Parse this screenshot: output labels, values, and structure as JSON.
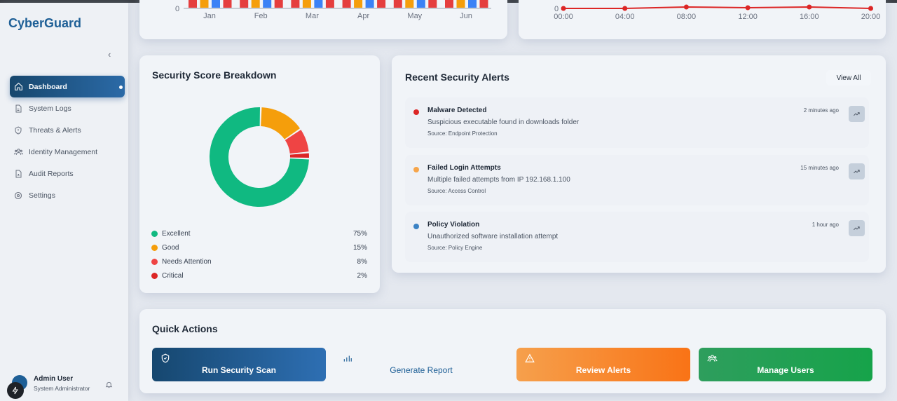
{
  "app": {
    "brand": "CyberGuard"
  },
  "sidebar": {
    "items": [
      {
        "label": "Dashboard",
        "icon": "home-icon",
        "active": true
      },
      {
        "label": "System Logs",
        "icon": "document-icon"
      },
      {
        "label": "Threats & Alerts",
        "icon": "shield-alert-icon"
      },
      {
        "label": "Identity Management",
        "icon": "users-icon"
      },
      {
        "label": "Audit Reports",
        "icon": "report-icon"
      },
      {
        "label": "Settings",
        "icon": "gear-icon"
      }
    ],
    "user": {
      "name": "Admin User",
      "role": "System Administrator"
    }
  },
  "top_bar_chart": {
    "months": [
      "Jan",
      "Feb",
      "Mar",
      "Apr",
      "May",
      "Jun"
    ],
    "y_tick": "0",
    "colors": [
      "#e53e3e",
      "#f59e0b",
      "#3b82f6"
    ]
  },
  "top_line_chart": {
    "times": [
      "00:00",
      "04:00",
      "08:00",
      "12:00",
      "16:00",
      "20:00"
    ],
    "y_tick": "0",
    "color": "#dc2626"
  },
  "score": {
    "title": "Security Score Breakdown",
    "chart_data": {
      "type": "pie",
      "categories": [
        "Excellent",
        "Good",
        "Needs Attention",
        "Critical"
      ],
      "values": [
        75,
        15,
        8,
        2
      ],
      "colors": [
        "#10b981",
        "#f59e0b",
        "#ef4444",
        "#dc2626"
      ]
    },
    "legend": [
      {
        "label": "Excellent",
        "pct": "75%",
        "color": "#10b981"
      },
      {
        "label": "Good",
        "pct": "15%",
        "color": "#f59e0b"
      },
      {
        "label": "Needs Attention",
        "pct": "8%",
        "color": "#ef4444"
      },
      {
        "label": "Critical",
        "pct": "2%",
        "color": "#dc2626"
      }
    ]
  },
  "alerts": {
    "title": "Recent Security Alerts",
    "view_all": "View All",
    "items": [
      {
        "title": "Malware Detected",
        "desc": "Suspicious executable found in downloads folder",
        "source": "Source: Endpoint Protection",
        "time": "2 minutes ago",
        "color": "#dc2626"
      },
      {
        "title": "Failed Login Attempts",
        "desc": "Multiple failed attempts from IP 192.168.1.100",
        "source": "Source: Access Control",
        "time": "15 minutes ago",
        "color": "#f6a54a"
      },
      {
        "title": "Policy Violation",
        "desc": "Unauthorized software installation attempt",
        "source": "Source: Policy Engine",
        "time": "1 hour ago",
        "color": "#3b82c4"
      }
    ]
  },
  "quick_actions": {
    "title": "Quick Actions",
    "buttons": [
      {
        "label": "Run Security Scan",
        "icon": "shield-check-icon"
      },
      {
        "label": "Generate Report",
        "icon": "bar-chart-icon"
      },
      {
        "label": "Review Alerts",
        "icon": "warning-icon"
      },
      {
        "label": "Manage Users",
        "icon": "users-icon"
      }
    ]
  }
}
